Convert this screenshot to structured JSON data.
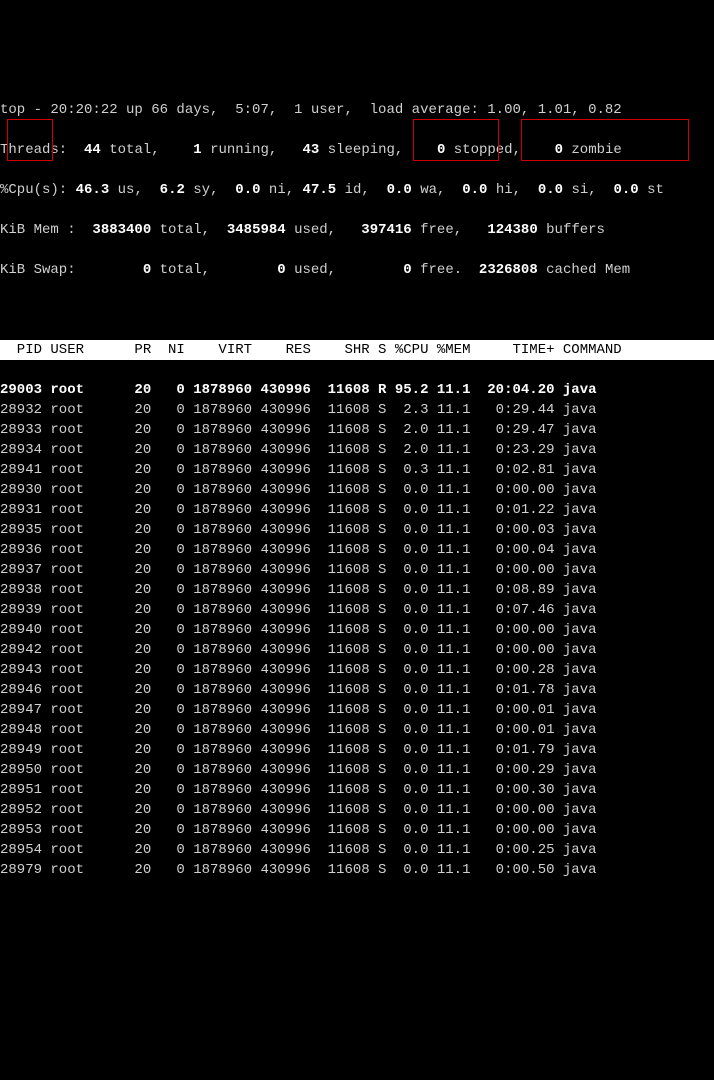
{
  "summary": {
    "line1_a": "top - 20:20:22 up 66 days,  5:07,  1 user,  load average: 1.00, 1.01, 0.82",
    "threads_label": "Threads:",
    "threads_total": "  44 ",
    "threads_total_l": "total,",
    "threads_run": "    1 ",
    "threads_run_l": "running,",
    "threads_sleep": "   43 ",
    "threads_sleep_l": "sleeping,",
    "threads_stop": "    0 ",
    "threads_stop_l": "stopped,",
    "threads_zom": "    0 ",
    "threads_zom_l": "zombie",
    "cpu_label": "%Cpu(s):",
    "cpu_us": " 46.3 ",
    "cpu_us_l": "us,",
    "cpu_sy": "  6.2 ",
    "cpu_sy_l": "sy,",
    "cpu_ni": "  0.0 ",
    "cpu_ni_l": "ni,",
    "cpu_id": " 47.5 ",
    "cpu_id_l": "id,",
    "cpu_wa": "  0.0 ",
    "cpu_wa_l": "wa,",
    "cpu_hi": "  0.0 ",
    "cpu_hi_l": "hi,",
    "cpu_si": "  0.0 ",
    "cpu_si_l": "si,",
    "cpu_st": "  0.0 ",
    "cpu_st_l": "st",
    "mem_label": "KiB Mem :",
    "mem_total": "  3883400 ",
    "mem_total_l": "total,",
    "mem_used": "  3485984 ",
    "mem_used_l": "used,",
    "mem_free": "   397416 ",
    "mem_free_l": "free,",
    "mem_buf": "   124380 ",
    "mem_buf_l": "buffers",
    "swap_label": "KiB Swap:",
    "swap_total": "        0 ",
    "swap_total_l": "total,",
    "swap_used": "        0 ",
    "swap_used_l": "used,",
    "swap_free": "        0 ",
    "swap_free_l": "free.",
    "swap_cache": "  2326808 ",
    "swap_cache_l": "cached Mem"
  },
  "columns": "  PID USER      PR  NI    VIRT    RES    SHR S %CPU %MEM     TIME+ COMMAND   ",
  "rows": [
    {
      "t": "29003 root      20   0 1878960 430996  11608 R 95.2 11.1  20:04.20 java       ",
      "bold": true
    },
    {
      "t": "28932 root      20   0 1878960 430996  11608 S  2.3 11.1   0:29.44 java       "
    },
    {
      "t": "28933 root      20   0 1878960 430996  11608 S  2.0 11.1   0:29.47 java       "
    },
    {
      "t": "28934 root      20   0 1878960 430996  11608 S  2.0 11.1   0:23.29 java       "
    },
    {
      "t": "28941 root      20   0 1878960 430996  11608 S  0.3 11.1   0:02.81 java       "
    },
    {
      "t": "28930 root      20   0 1878960 430996  11608 S  0.0 11.1   0:00.00 java       "
    },
    {
      "t": "28931 root      20   0 1878960 430996  11608 S  0.0 11.1   0:01.22 java       "
    },
    {
      "t": "28935 root      20   0 1878960 430996  11608 S  0.0 11.1   0:00.03 java       "
    },
    {
      "t": "28936 root      20   0 1878960 430996  11608 S  0.0 11.1   0:00.04 java       "
    },
    {
      "t": "28937 root      20   0 1878960 430996  11608 S  0.0 11.1   0:00.00 java       "
    },
    {
      "t": "28938 root      20   0 1878960 430996  11608 S  0.0 11.1   0:08.89 java       "
    },
    {
      "t": "28939 root      20   0 1878960 430996  11608 S  0.0 11.1   0:07.46 java       "
    },
    {
      "t": "28940 root      20   0 1878960 430996  11608 S  0.0 11.1   0:00.00 java       "
    },
    {
      "t": "28942 root      20   0 1878960 430996  11608 S  0.0 11.1   0:00.00 java       "
    },
    {
      "t": "28943 root      20   0 1878960 430996  11608 S  0.0 11.1   0:00.28 java       "
    },
    {
      "t": "28946 root      20   0 1878960 430996  11608 S  0.0 11.1   0:01.78 java       "
    },
    {
      "t": "28947 root      20   0 1878960 430996  11608 S  0.0 11.1   0:00.01 java       "
    },
    {
      "t": "28948 root      20   0 1878960 430996  11608 S  0.0 11.1   0:00.01 java       "
    },
    {
      "t": "28949 root      20   0 1878960 430996  11608 S  0.0 11.1   0:01.79 java       "
    },
    {
      "t": "28950 root      20   0 1878960 430996  11608 S  0.0 11.1   0:00.29 java       "
    },
    {
      "t": "28951 root      20   0 1878960 430996  11608 S  0.0 11.1   0:00.30 java       "
    },
    {
      "t": "28952 root      20   0 1878960 430996  11608 S  0.0 11.1   0:00.00 java       "
    },
    {
      "t": "28953 root      20   0 1878960 430996  11608 S  0.0 11.1   0:00.00 java       "
    },
    {
      "t": "28954 root      20   0 1878960 430996  11608 S  0.0 11.1   0:00.25 java       "
    },
    {
      "t": "28979 root      20   0 1878960 430996  11608 S  0.0 11.1   0:00.50 java       "
    }
  ]
}
